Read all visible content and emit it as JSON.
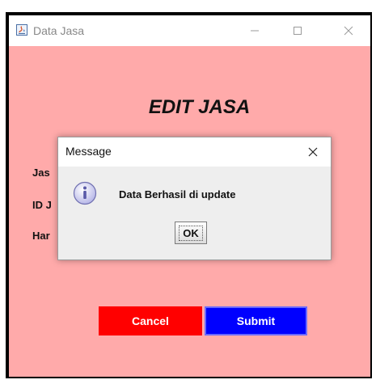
{
  "window": {
    "title": "Data Jasa",
    "icon": "java-app-icon",
    "controls": [
      "minimize-icon",
      "maximize-icon",
      "close-icon"
    ],
    "background_color": "#ffaaaa"
  },
  "form": {
    "heading": "EDIT JASA",
    "labels": [
      "Jas",
      "ID J",
      "Har"
    ],
    "cancel_label": "Cancel",
    "submit_label": "Submit",
    "cancel_color": "#ff0000",
    "submit_color": "#0000ff"
  },
  "dialog": {
    "title": "Message",
    "icon": "info-icon",
    "message": "Data Berhasil di update",
    "ok_label": "OK"
  }
}
